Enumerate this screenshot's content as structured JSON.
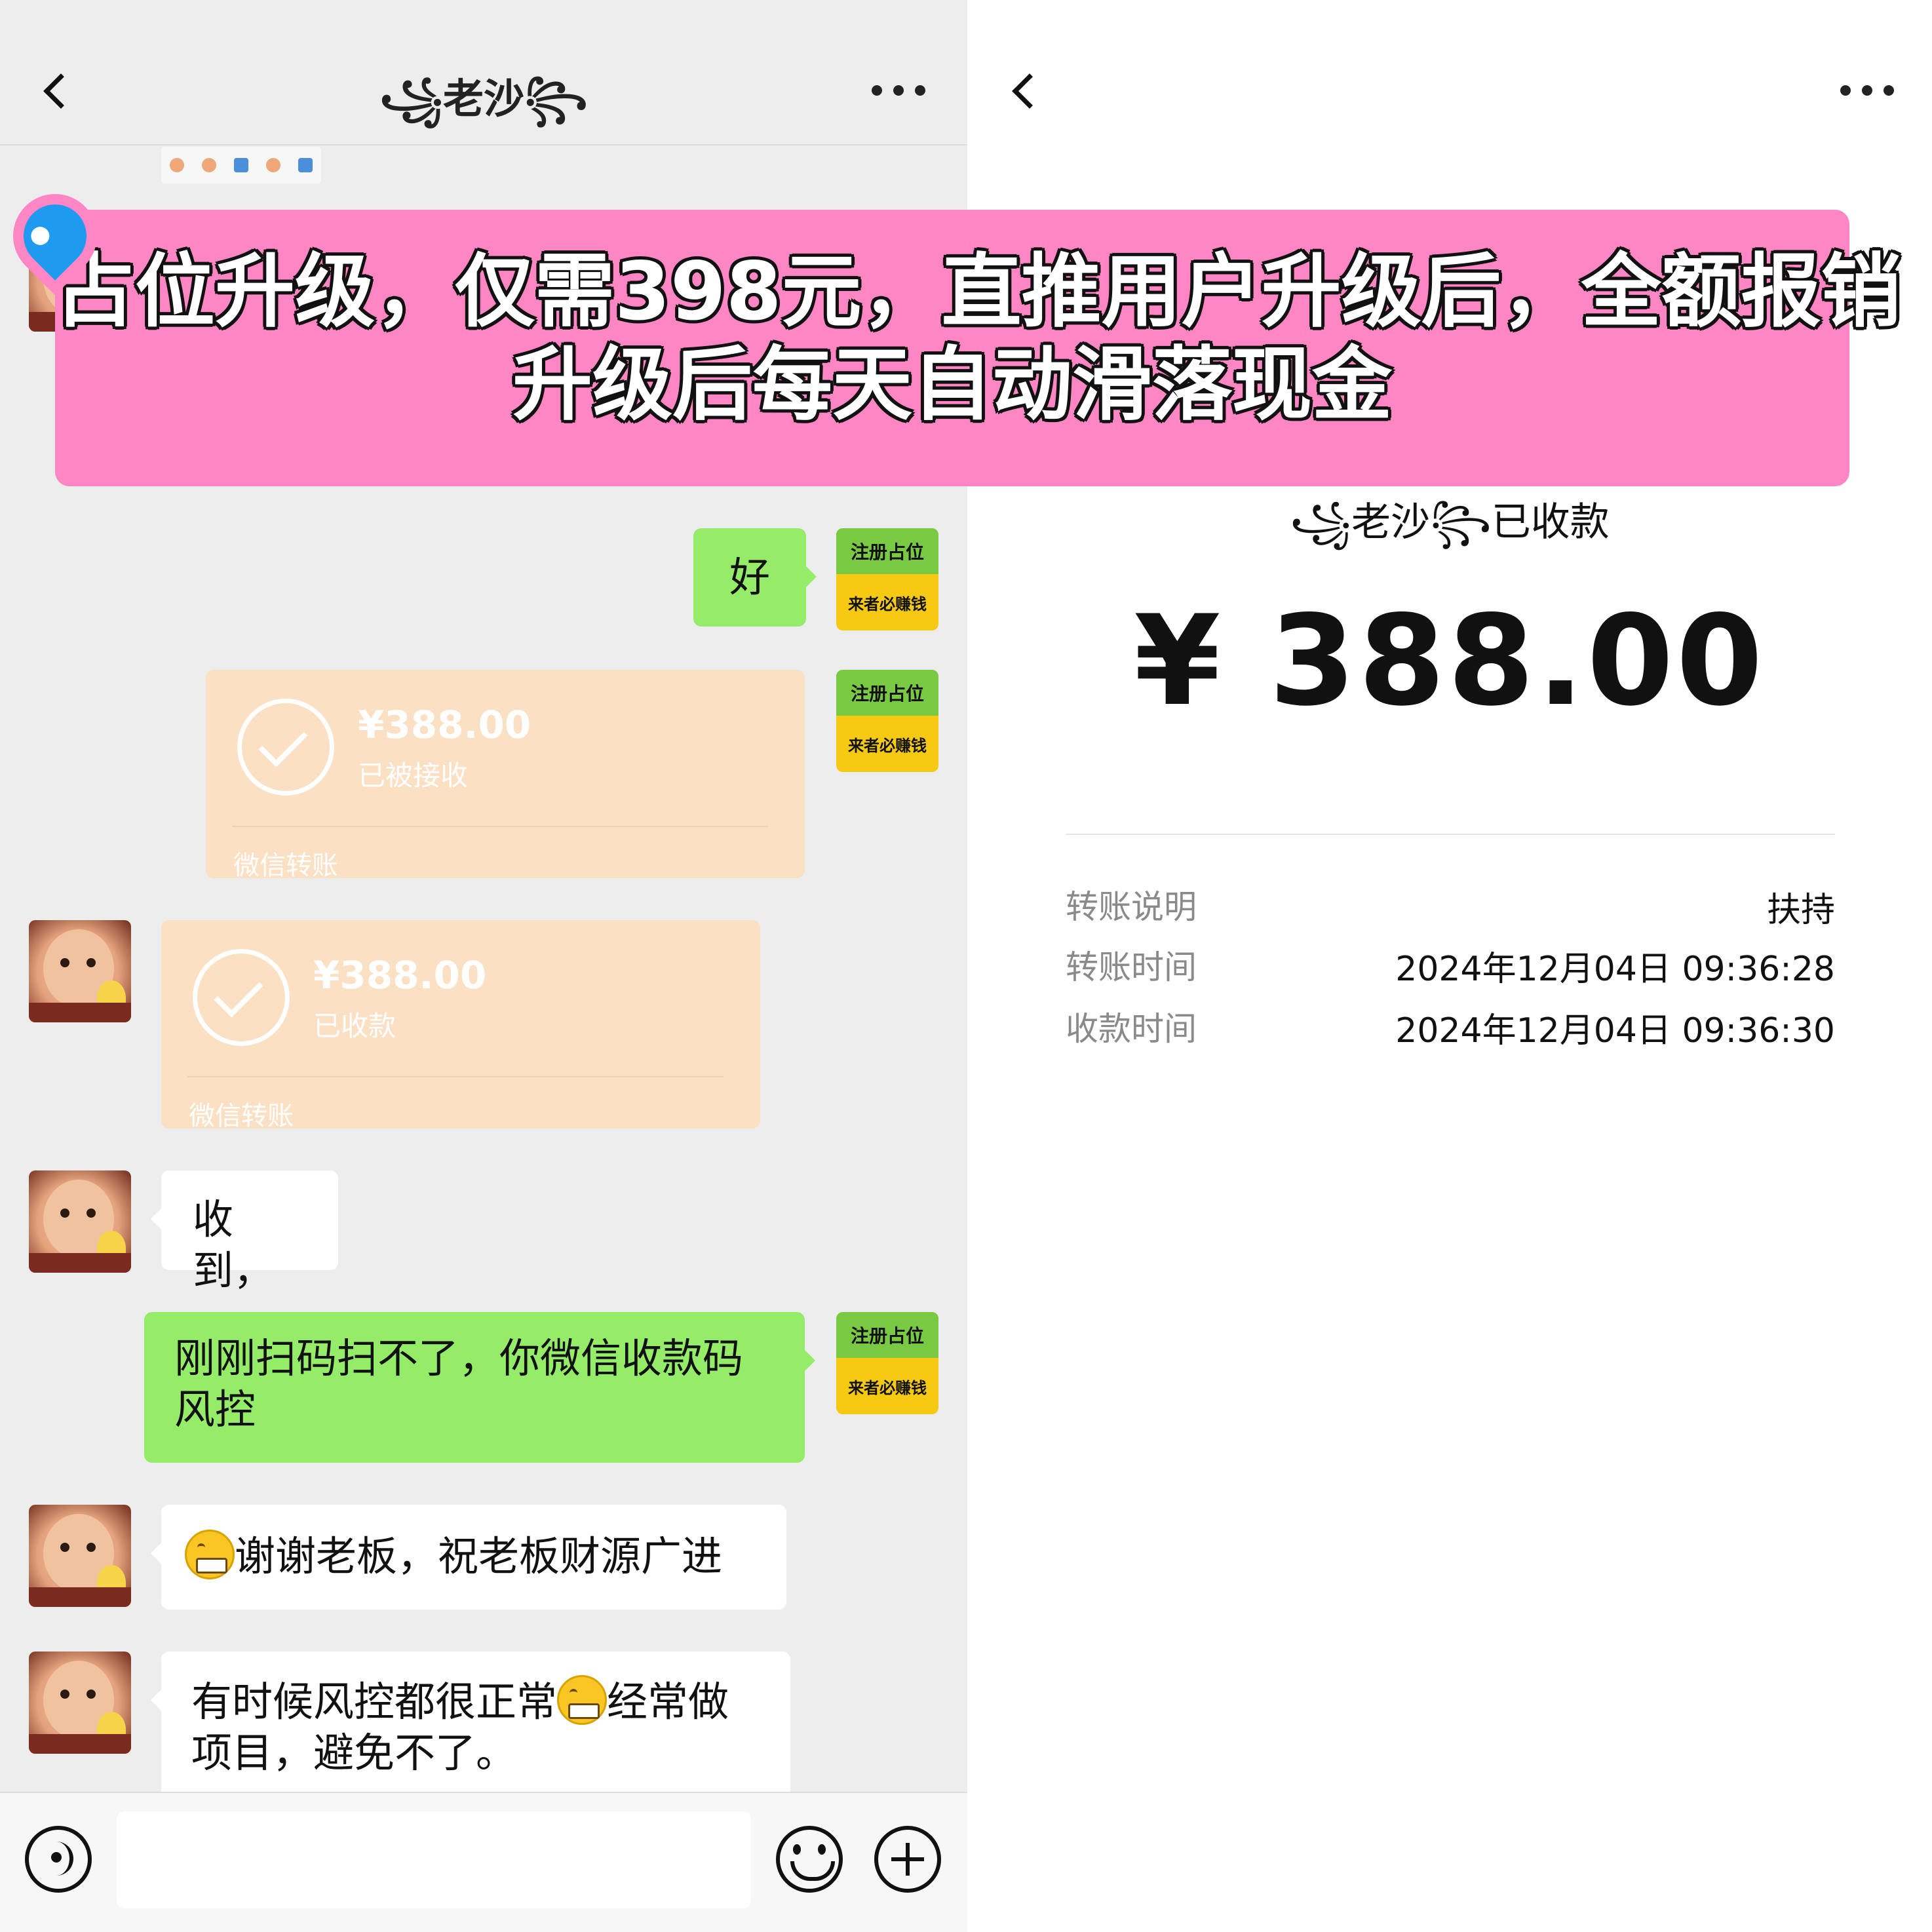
{
  "banner": {
    "line1": "占位升级，仅需398元，直推用户升级后，全额报销",
    "line2": "升级后每天自动滑落现金"
  },
  "chat": {
    "title": "꧁老沙꧂",
    "badge": {
      "top": "注册占位",
      "bottom": "来者必赚钱"
    },
    "messages": {
      "m1": "好",
      "t1": {
        "amount": "¥388.00",
        "status": "已被接收",
        "footer": "微信转账"
      },
      "t2": {
        "amount": "¥388.00",
        "status": "已收款",
        "footer": "微信转账"
      },
      "m2": "收到，",
      "m3": "刚刚扫码扫不了，你微信收款码风控",
      "m4": "谢谢老板，祝老板财源广进",
      "m5a": "有时候风控都很正常",
      "m5b": "经常做项目，避免不了。"
    }
  },
  "receipt": {
    "status": "꧁老沙꧂已收款",
    "amount": "¥ 388.00",
    "rows": [
      {
        "label": "转账说明",
        "value": "扶持"
      },
      {
        "label": "转账时间",
        "value": "2024年12月04日 09:36:28"
      },
      {
        "label": "收款时间",
        "value": "2024年12月04日 09:36:30"
      }
    ]
  },
  "colors": {
    "chat_background": "#ededed",
    "sent_bubble": "#95ec69",
    "transfer_card": "#fbe0c4",
    "banner": "#ff86c4",
    "pin": "#1e9bf0"
  },
  "icons": {
    "back": "chevron-left-icon",
    "more": "more-dots-icon",
    "voice": "voice-icon",
    "emoji": "emoji-icon",
    "plus": "plus-icon",
    "transfer_check": "check-circle-icon",
    "grin": "grinning-emoji-icon",
    "pin": "location-pin-icon"
  }
}
